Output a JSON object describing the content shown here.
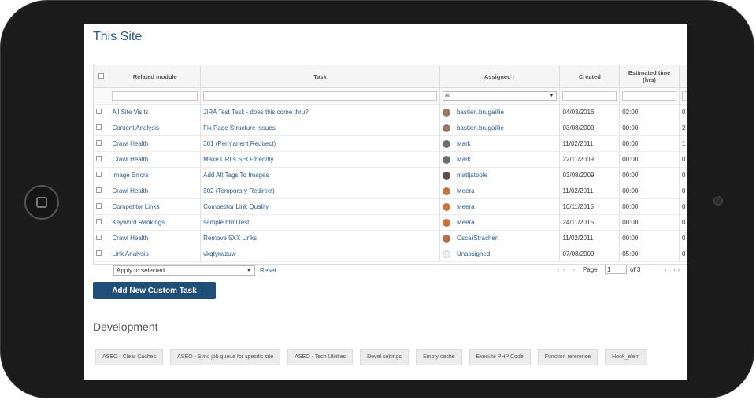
{
  "site": {
    "title": "This Site"
  },
  "tasks_table": {
    "headers": {
      "related_module": "Related module",
      "task": "Task",
      "assigned": "Assigned",
      "assigned_sort": "↑",
      "created": "Created",
      "estimated": "Estimated time (hrs)"
    },
    "filter": {
      "assigned_value": "All"
    },
    "rows": [
      {
        "module": "All Site Visits",
        "task": "JIRA Test Task - does this come thru?",
        "assigned": "bastien.brugaillie",
        "created": "04/03/2016",
        "estimated": "02:00",
        "extra": "0"
      },
      {
        "module": "Content Analysis",
        "task": "Fix Page Structure Issues",
        "assigned": "bastien.brugaillie",
        "created": "03/08/2009",
        "estimated": "00:00",
        "extra": "2"
      },
      {
        "module": "Crawl Health",
        "task": "301 (Permanent Redirect)",
        "assigned": "Mark",
        "created": "11/02/2011",
        "estimated": "00:00",
        "extra": "1"
      },
      {
        "module": "Crawl Health",
        "task": "Make URLs SEO-friendly",
        "assigned": "Mark",
        "created": "22/11/2009",
        "estimated": "00:00",
        "extra": "0"
      },
      {
        "module": "Image Errors",
        "task": "Add Alt Tags To Images",
        "assigned": "mattjatoole",
        "created": "03/08/2009",
        "estimated": "00:00",
        "extra": "0"
      },
      {
        "module": "Crawl Health",
        "task": "302 (Temporary Redirect)",
        "assigned": "Meera",
        "created": "11/02/2011",
        "estimated": "00:00",
        "extra": "0"
      },
      {
        "module": "Competitor Links",
        "task": "Competitor Link Quality",
        "assigned": "Meera",
        "created": "10/11/2015",
        "estimated": "00:00",
        "extra": "0"
      },
      {
        "module": "Keyword Rankings",
        "task": "sample html test",
        "assigned": "Meera",
        "created": "24/11/2015",
        "estimated": "00:00",
        "extra": "0"
      },
      {
        "module": "Crawl Health",
        "task": "Remove 5XX Links",
        "assigned": "OscarStrachen",
        "created": "11/02/2011",
        "estimated": "00:00",
        "extra": "0"
      },
      {
        "module": "Link Analysis",
        "task": "vkqtyrwzuw",
        "assigned": "Unassigned",
        "created": "07/08/2009",
        "estimated": "05:00",
        "extra": "0"
      }
    ]
  },
  "toolbar": {
    "bulk_action": "Apply to selected...",
    "reset": "Reset",
    "pager_prev": "‹‹ ‹",
    "page_label": "Page",
    "page_value": "1",
    "page_of": "of 3",
    "pager_next": "› ››"
  },
  "add_task_button": "Add New Custom Task",
  "development": {
    "title": "Development",
    "buttons": [
      "ASEO - Clear Caches",
      "ASEO - Sync job queue for specific site",
      "ASEO - Tech Utilities",
      "Devel settings",
      "Empty cache",
      "Execute PHP Code",
      "Function reference",
      "Hook_elem"
    ]
  },
  "colors": {
    "accent": "#1f4e79",
    "link": "#2b5a8a",
    "device_frame": "#1b1b1b"
  },
  "icons": {
    "home": "home-button-icon",
    "camera": "camera-icon",
    "avatar": "user-avatar-icon"
  }
}
